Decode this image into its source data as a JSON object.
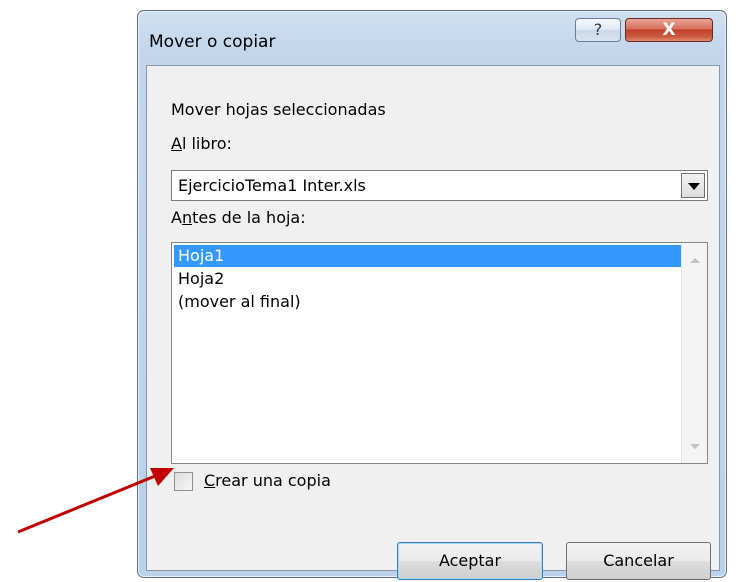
{
  "window": {
    "title": "Mover o copiar",
    "help_glyph": "?",
    "close_glyph": "X"
  },
  "dialog": {
    "move_label": "Mover hojas seleccionadas",
    "book_label_accel": "A",
    "book_label_rest": "l libro:",
    "book_value": "EjercicioTema1 Inter.xls",
    "before_label_pre": "A",
    "before_label_accel": "n",
    "before_label_rest": "tes de la hoja:",
    "sheets": [
      "Hoja1",
      "Hoja2",
      "(mover al final)"
    ],
    "selected_index": 0,
    "copy_label_accel": "C",
    "copy_label_rest": "rear una copia",
    "copy_checked": false,
    "ok_label": "Aceptar",
    "cancel_label": "Cancelar"
  },
  "colors": {
    "selection": "#3399ff",
    "annotation_arrow": "#c00000"
  }
}
